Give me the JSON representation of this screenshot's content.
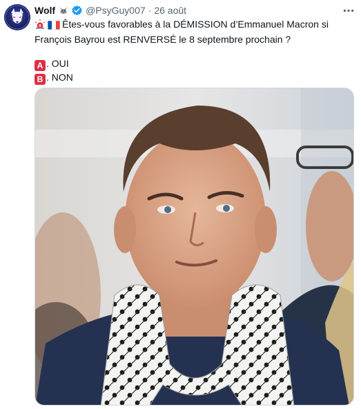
{
  "author": {
    "name": "Wolf",
    "handle": "@PsyGuy007",
    "separator": "·",
    "date": "26 août",
    "verified": true
  },
  "icons": {
    "avatar": "wolf-avatar",
    "name_emoji": "wolf-emoji-icon",
    "verified": "verified-badge-icon",
    "more": "more-options-icon",
    "siren": "siren-emoji-icon",
    "flag": "french-flag-icon"
  },
  "tweet": {
    "line1": "Êtes-vous favorables à la DÉMISSION d’Emmanuel Macron si",
    "line2": "François Bayrou est RENVERSÉ le 8 septembre prochain ?",
    "option_a_letter": "A",
    "option_a_text": ". OUI",
    "option_b_letter": "B",
    "option_b_text": ". NON"
  },
  "media": {
    "type": "photo"
  },
  "colors": {
    "text": "#0f1419",
    "secondary": "#536471",
    "verified": "#1d9bf0",
    "badge": "#dd2e44"
  }
}
